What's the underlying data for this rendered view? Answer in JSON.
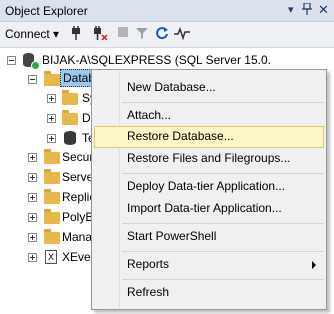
{
  "panel": {
    "title": "Object Explorer",
    "pin_icon": "pin-icon",
    "close_icon": "close-icon",
    "menu_icon": "dropdown-icon"
  },
  "toolbar": {
    "connect_label": "Connect ▾",
    "icons": [
      "connect-plug-icon",
      "disconnect-plug-icon",
      "stop-icon",
      "filter-icon",
      "refresh-icon",
      "activity-monitor-icon"
    ]
  },
  "tree": {
    "server": "BIJAK-A\\SQLEXPRESS (SQL Server 15.0.",
    "databases": "Datab",
    "children": [
      "Sy",
      "D",
      "Te"
    ],
    "siblings": [
      "Secur",
      "Serve",
      "Replic",
      "PolyB",
      "Mana",
      "XEver"
    ]
  },
  "context_menu": {
    "items": [
      {
        "label": "New Database..."
      },
      {
        "label": "Attach..."
      },
      {
        "label": "Restore Database..."
      },
      {
        "label": "Restore Files and Filegroups..."
      },
      {
        "label": "Deploy Data-tier Application..."
      },
      {
        "label": "Import Data-tier Application..."
      },
      {
        "label": "Start PowerShell"
      },
      {
        "label": "Reports"
      },
      {
        "label": "Refresh"
      }
    ],
    "highlighted": "Restore Database...",
    "submenu_item": "Reports"
  },
  "colors": {
    "titlebar_bg": "#dbe2ee",
    "selection_bg": "#99c9ef",
    "highlight_bg": "#fdf6c8",
    "highlight_border": "#e0c86a",
    "folder": "#e7b94a"
  }
}
